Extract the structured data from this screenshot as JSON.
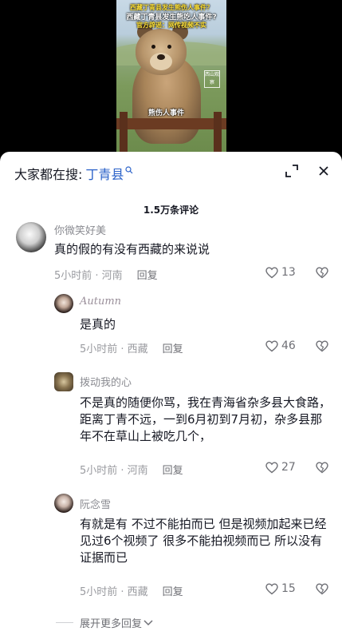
{
  "video": {
    "caption_top": "西藏丁青县发生熊伤人事件？",
    "caption_title": "西藏丁青县发生熊吃人事件?",
    "caption_sub": "官方辟谣：网传视频不实",
    "caption_mid": "熊伤人事件",
    "logo": "西山观察"
  },
  "search": {
    "prefix": "大家都在搜:",
    "term": "丁青县"
  },
  "comments_count": "1.5万条评论",
  "comments": [
    {
      "name": "你微笑好美",
      "text": "真的假的有没有西藏的来说说",
      "time": "5小时前 · 河南",
      "reply": "回复",
      "likes": "13"
    },
    {
      "name": "Autumn",
      "text": "是真的",
      "time": "5小时前 · 西藏",
      "reply": "回复",
      "likes": "46"
    },
    {
      "name": "拨动我的心",
      "text": "不是真的随便你骂，我在青海省杂多县大食路，距离丁青不远，一到6月初到7月初，杂多县那年不在草山上被吃几个，",
      "time": "5小时前 · 河南",
      "reply": "回复",
      "likes": "27"
    },
    {
      "name": "阮念雪",
      "text": "有就是有 不过不能拍而已 但是视频加起来已经见过6个视频了 很多不能拍视频而已 所以没有证据而已",
      "time": "5小时前 · 西藏",
      "reply": "回复",
      "likes": "15"
    }
  ],
  "expand_label": "展开更多回复",
  "colors": {
    "accent_link": "#2b62c9",
    "text_primary": "#161823",
    "text_secondary": "#8a8b91"
  }
}
